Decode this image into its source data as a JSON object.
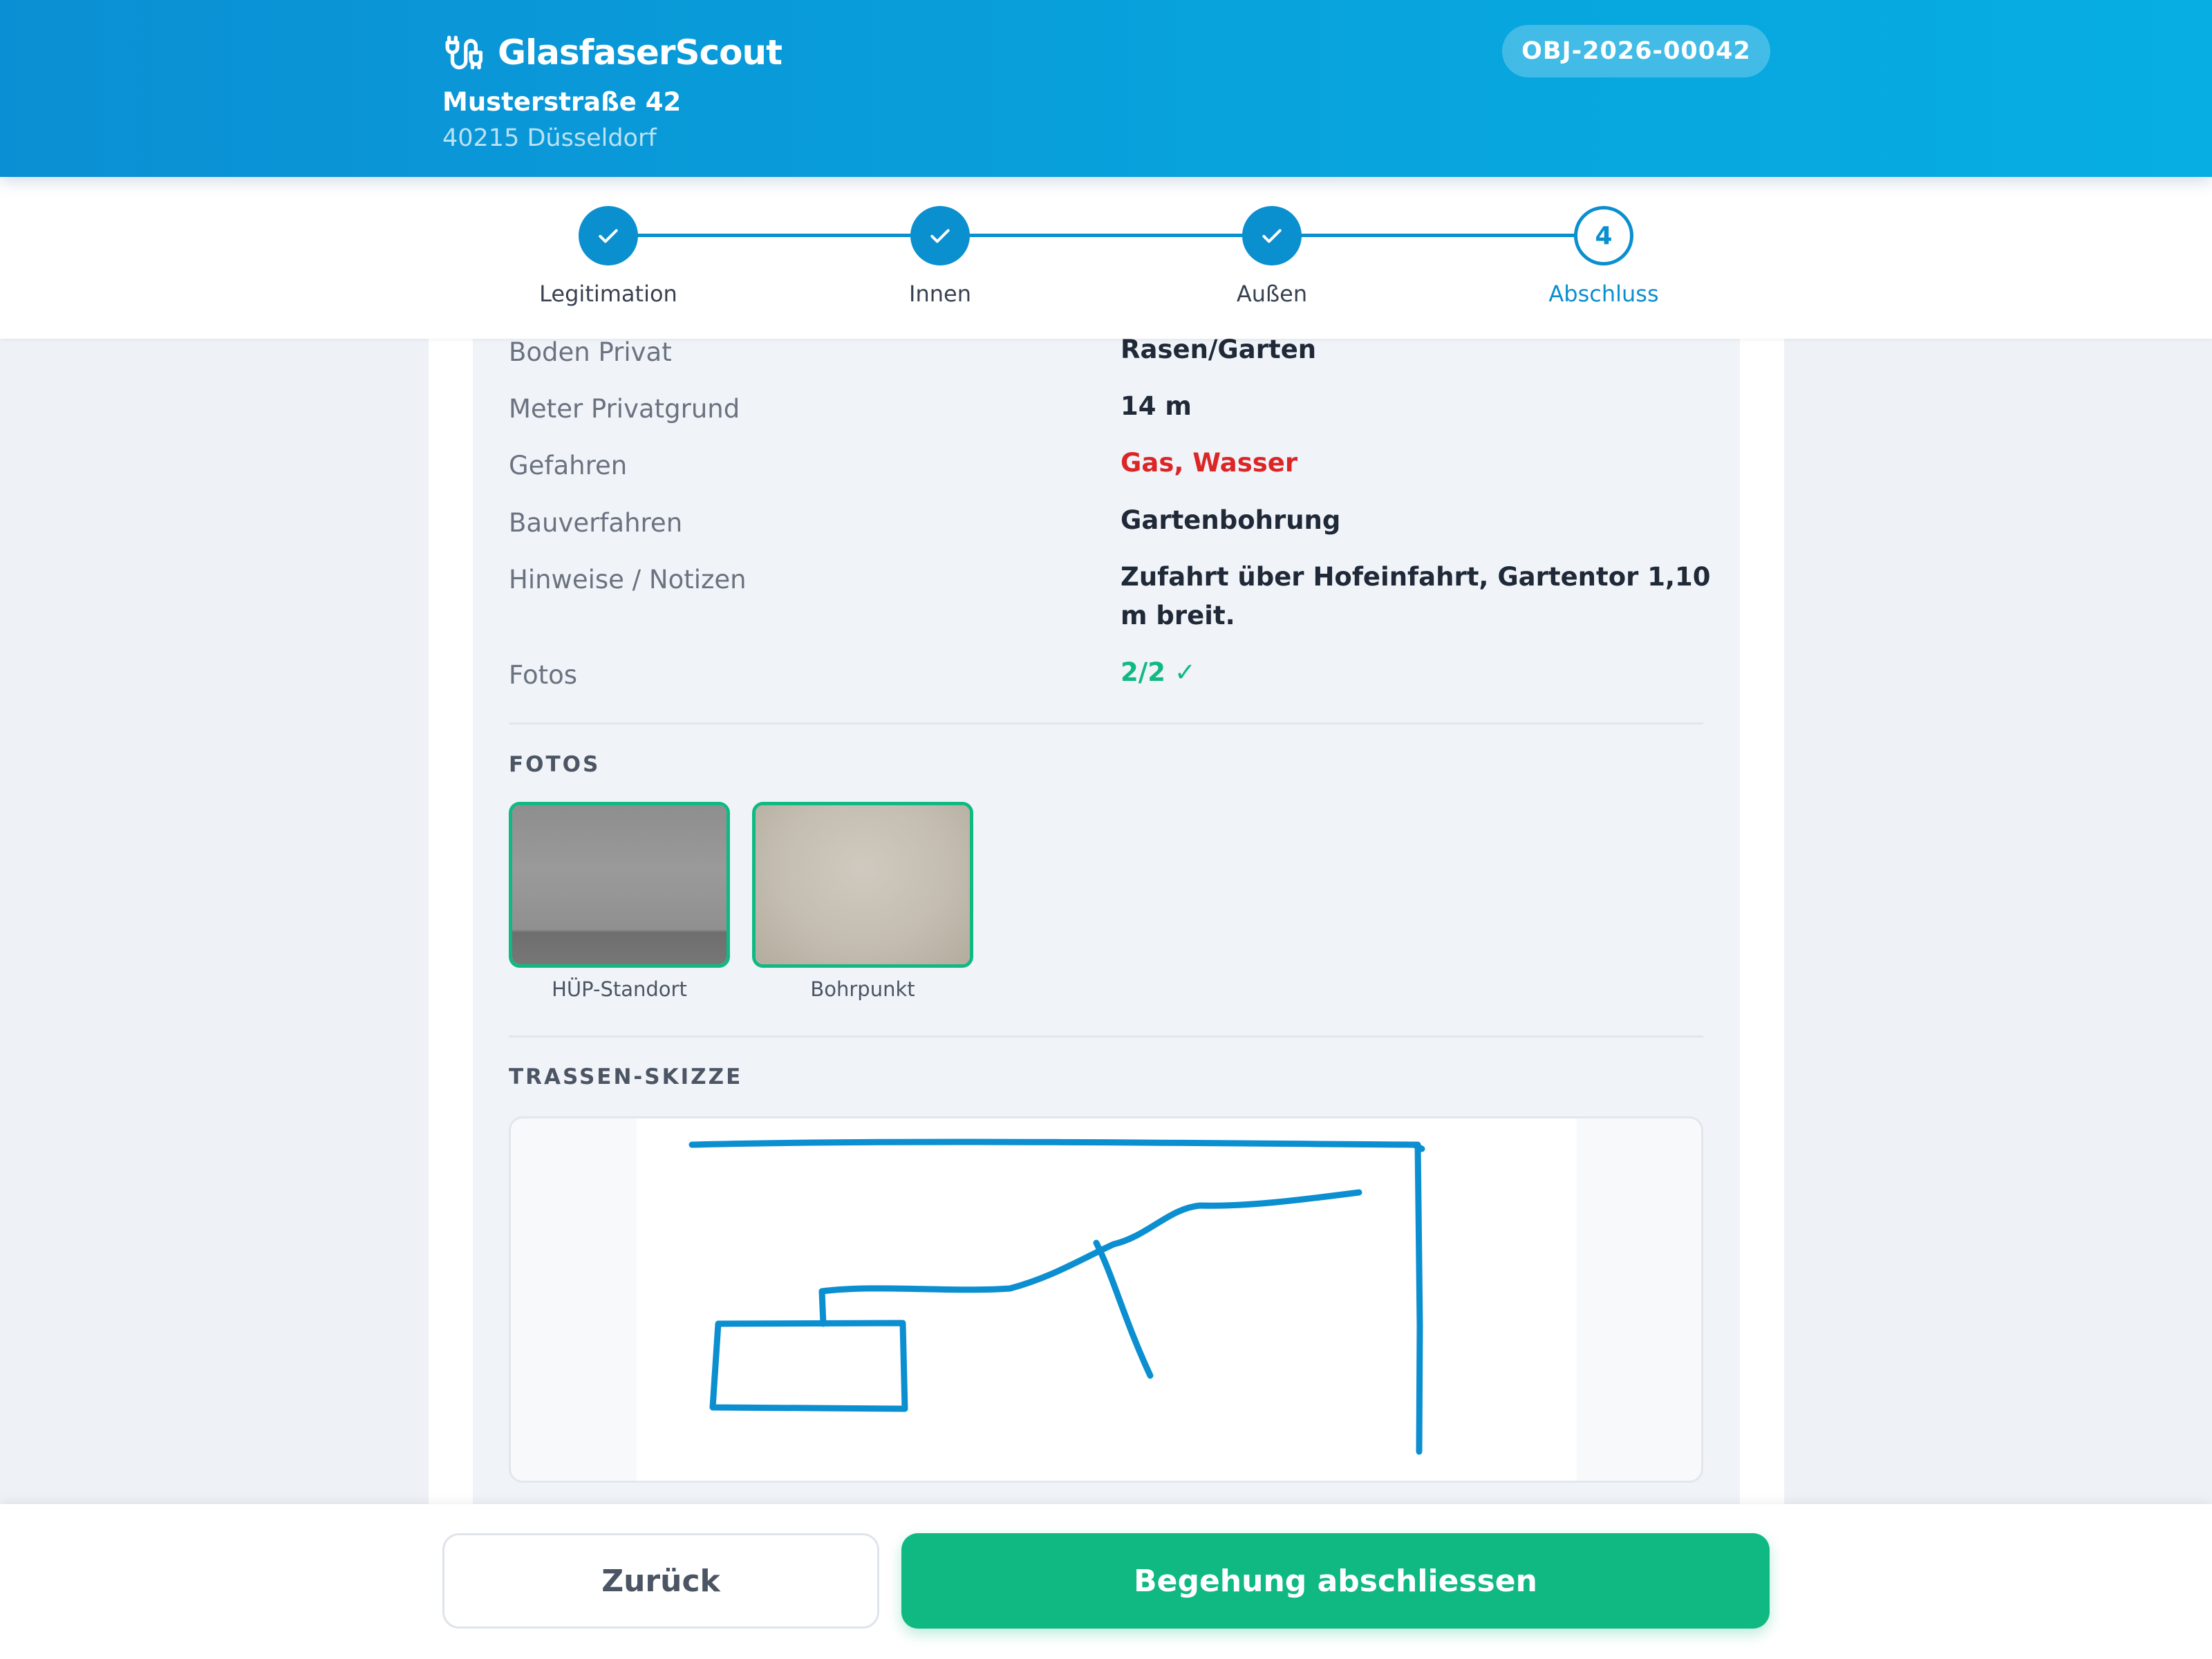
{
  "header": {
    "app_name": "GlasfaserScout",
    "street": "Musterstraße 42",
    "city": "40215 Düsseldorf",
    "object_id": "OBJ-2026-00042"
  },
  "stepper": {
    "steps": [
      {
        "label": "Legitimation",
        "state": "done"
      },
      {
        "label": "Innen",
        "state": "done"
      },
      {
        "label": "Außen",
        "state": "done"
      },
      {
        "label": "Abschluss",
        "state": "current",
        "number": "4"
      }
    ]
  },
  "summary": {
    "rows": [
      {
        "label": "Boden Privat",
        "value": "Rasen/Garten"
      },
      {
        "label": "Meter Privatgrund",
        "value": "14 m"
      },
      {
        "label": "Gefahren",
        "value": "Gas, Wasser"
      },
      {
        "label": "Bauverfahren",
        "value": "Gartenbohrung"
      },
      {
        "label": "Hinweise / Notizen",
        "value": "Zufahrt über Hofeinfahrt, Gartentor 1,10 m breit."
      },
      {
        "label": "Fotos",
        "value": "2/2 ✓"
      }
    ]
  },
  "photos": {
    "title": "FOTOS",
    "items": [
      {
        "caption": "HÜP-Standort"
      },
      {
        "caption": "Bohrpunkt"
      }
    ]
  },
  "sketch": {
    "title": "TRASSEN-SKIZZE"
  },
  "footer": {
    "back_label": "Zurück",
    "finish_label": "Begehung abschliessen"
  },
  "colors": {
    "primary": "#0a8fcf",
    "success": "#10b981",
    "danger": "#dc2626"
  }
}
